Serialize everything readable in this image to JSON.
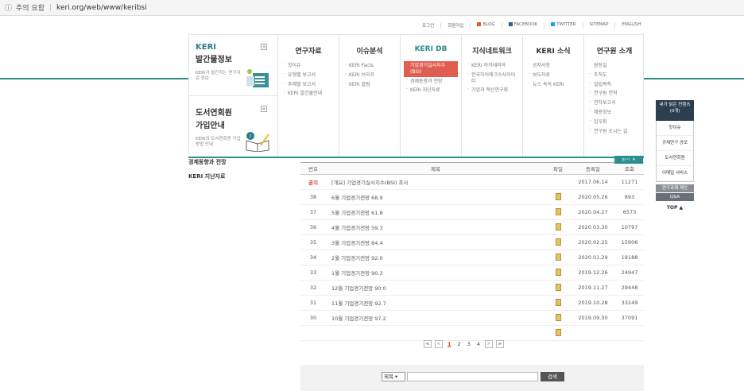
{
  "browser": {
    "security_label": "주의 요함",
    "url": "keri.org/web/www/keribsi"
  },
  "util_links": [
    "로그인",
    "회원가입",
    "BLOG",
    "FACEBOOK",
    "TWITTER",
    "SITEMAP",
    "ENGLISH"
  ],
  "promo": {
    "p1": {
      "title1": "KERI",
      "title2": "발간물정보",
      "desc": "KERI가 발간하는 연구자료 정보"
    },
    "p2": {
      "title1": "도서연회원",
      "title2": "가입안내",
      "desc": "KERI의 도서연회원 가입방법 안내"
    }
  },
  "menu": [
    {
      "title": "연구자료",
      "items": [
        "핫이슈",
        "유형별 보고서",
        "주제별 보고서",
        "KERI 발간물안내"
      ]
    },
    {
      "title": "이슈분석",
      "items": [
        "KERI Facts",
        "KERI 브리프",
        "KERI 칼럼"
      ]
    },
    {
      "title": "KERI DB",
      "items": [
        "기업경기실사지수(BSI)",
        "경제동향과 전망",
        "KERI 지난자료"
      ]
    },
    {
      "title": "지식네트워크",
      "items": [
        "KERI 아카데미아",
        "한국하이에크소사이어티",
        "기업과 혁신연구회"
      ]
    },
    {
      "title": "KERI 소식",
      "items": [
        "공지사항",
        "보도자료",
        "뉴스 속의 KERI"
      ]
    },
    {
      "title": "연구원 소개",
      "items": [
        "원장실",
        "조직도",
        "설립목적",
        "연구원 연혁",
        "연차보고서",
        "채용정보",
        "임우회",
        "연구원 오시는 길"
      ]
    }
  ],
  "close_label": "닫기 ✕",
  "subnav": [
    "경제동향과 전망",
    "KERI 지난자료"
  ],
  "table": {
    "headers": {
      "no": "번호",
      "title": "제목",
      "file": "파일",
      "date": "등록일",
      "views": "조회"
    },
    "rows": [
      {
        "no": "공지",
        "title": "[개요] 기업경기실사지수(BSI) 조사",
        "file": false,
        "date": "2017.06.14",
        "views": "11271"
      },
      {
        "no": "38",
        "title": "6월 기업경기전망 68.9",
        "file": true,
        "date": "2020.05.26",
        "views": "893"
      },
      {
        "no": "37",
        "title": "5월 기업경기전망 61.8",
        "file": true,
        "date": "2020.04.27",
        "views": "6573"
      },
      {
        "no": "36",
        "title": "4월 기업경기전망 59.3",
        "file": true,
        "date": "2020.03.30",
        "views": "10797"
      },
      {
        "no": "35",
        "title": "3월 기업경기전망 84.4",
        "file": true,
        "date": "2020.02.25",
        "views": "15906"
      },
      {
        "no": "34",
        "title": "2월 기업경기전망 92.0",
        "file": true,
        "date": "2020.01.29",
        "views": "19188"
      },
      {
        "no": "33",
        "title": "1월 기업경기전망 90.3",
        "file": true,
        "date": "2019.12.26",
        "views": "24947"
      },
      {
        "no": "32",
        "title": "12월 기업경기전망 90.0",
        "file": true,
        "date": "2019.11.27",
        "views": "29448"
      },
      {
        "no": "31",
        "title": "11월 기업경기전망 92.7",
        "file": true,
        "date": "2019.10.28",
        "views": "33249"
      },
      {
        "no": "30",
        "title": "10월 기업경기전망 97.2",
        "file": true,
        "date": "2019.09.30",
        "views": "37091"
      }
    ]
  },
  "pager": {
    "first": "≪",
    "prev": "<",
    "pages": [
      "1",
      "2",
      "3",
      "4"
    ],
    "current": "1",
    "next": ">",
    "last": "≫"
  },
  "search": {
    "field": "제목 ▾",
    "button": "검색"
  },
  "quick": {
    "top": "내가 읽은 컨텐츠 (0개)",
    "links": [
      "핫이슈",
      "규제연구 공모",
      "도서연회원",
      "이메일 서비스"
    ],
    "g1": "연구과제 제안",
    "g2": "Q&A",
    "top_btn": "TOP ▲"
  },
  "colors": {
    "teal": "#2a8f8e",
    "accent_red": "#e05e4f",
    "navy": "#2c3e50"
  }
}
